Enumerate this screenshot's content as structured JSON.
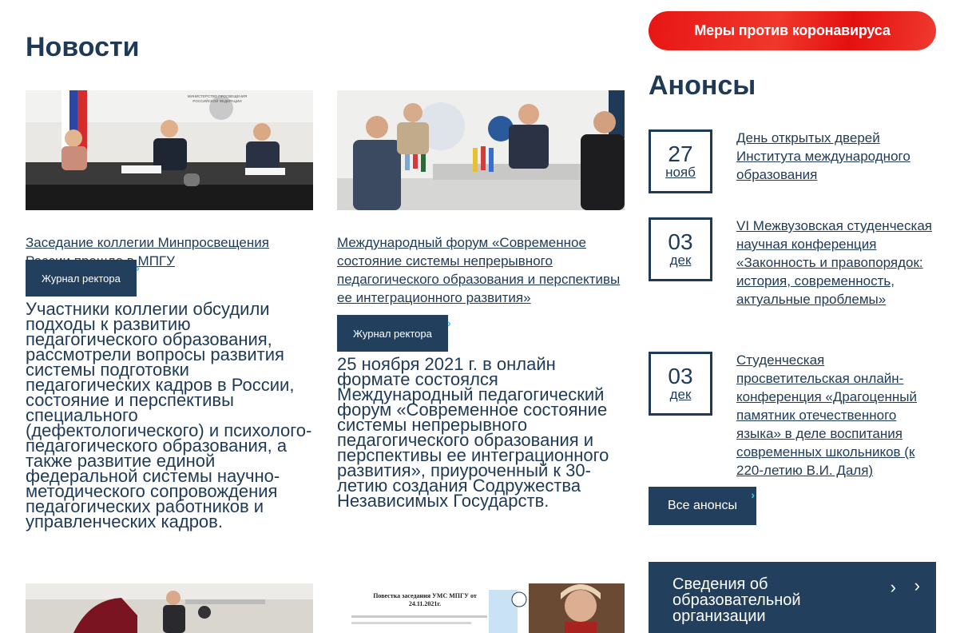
{
  "covid_button": "Меры против коронавируса",
  "news": {
    "title": "Новости",
    "cards": [
      {
        "link": "Заседание коллегии Минпросвещения России прошло в МПГУ",
        "tag": "Журнал ректора",
        "excerpt": "Участники коллегии обсудили подходы к развитию педагогического образования, рассмотрели вопросы развития системы подготовки педагогических кадров в России, состояние и перспективы специального (дефектологического) и психолого-педагогического образования, а также развитие единой федеральной системы научно-методического сопровождения педагогических работников и управленческих кадров."
      },
      {
        "link": "Международный форум «Современное состояние системы непрерывного педагогического образования и перспективы ее интеграционного развития»",
        "tag": "Журнал ректора",
        "excerpt": "25 ноября 2021 г. в онлайн формате состоялся Международный педагогический форум «Современное состояние системы непрерывного педагогического образования и перспективы ее интеграционного развития», приуроченный к 30-летию создания Содружества Независимых Государств."
      }
    ],
    "bottom_doc": {
      "title": "Повестка заседания УМС МПГУ от 24.11.2021г."
    }
  },
  "announcements": {
    "title": "Анонсы",
    "items": [
      {
        "day": "27",
        "month": "нояб",
        "text": "День открытых дверей Института международного образования"
      },
      {
        "day": "03",
        "month": "дек",
        "text": "VI Межвузовская студенческая научная конференция «Законность и правопорядок: история, современность, актуальные проблемы»"
      },
      {
        "day": "03",
        "month": "дек",
        "text": "Студенческая просветительская онлайн-конференция «Драгоценный памятник отечественного языка» в деле воспитания современных школьников (к 220-летию В.И. Даля)"
      }
    ],
    "all_button": "Все анонсы"
  },
  "org_panel": "Сведения об образовательной организации",
  "photo1_sign": "МИНИСТЕРСТВО ПРОСВЕЩЕНИЯ РОССИЙСКОЙ ФЕДЕРАЦИИ"
}
